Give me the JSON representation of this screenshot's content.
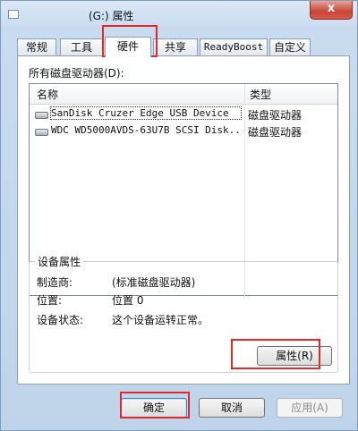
{
  "window": {
    "title": "(G:) 属性",
    "close_glyph": "x"
  },
  "tabs": [
    "常规",
    "工具",
    "硬件",
    "共享",
    "ReadyBoost",
    "自定义"
  ],
  "active_tab": "硬件",
  "drives_label": "所有磁盘驱动器(D):",
  "list": {
    "columns": {
      "name": "名称",
      "type": "类型"
    },
    "rows": [
      {
        "name": "SanDisk Cruzer Edge USB Device",
        "type": "磁盘驱动器"
      },
      {
        "name": "WDC WD5000AVDS-63U7B SCSI Disk...",
        "type": "磁盘驱动器"
      }
    ]
  },
  "device_properties": {
    "title": "设备属性",
    "manufacturer_label": "制造商:",
    "manufacturer": "(标准磁盘驱动器)",
    "location_label": "位置:",
    "location": "位置 0",
    "status_label": "设备状态:",
    "status": "这个设备运转正常。",
    "properties_button": "属性(R)"
  },
  "buttons": {
    "ok": "确定",
    "cancel": "取消",
    "apply": "应用(A)"
  },
  "highlight_color": "#e02a2a"
}
